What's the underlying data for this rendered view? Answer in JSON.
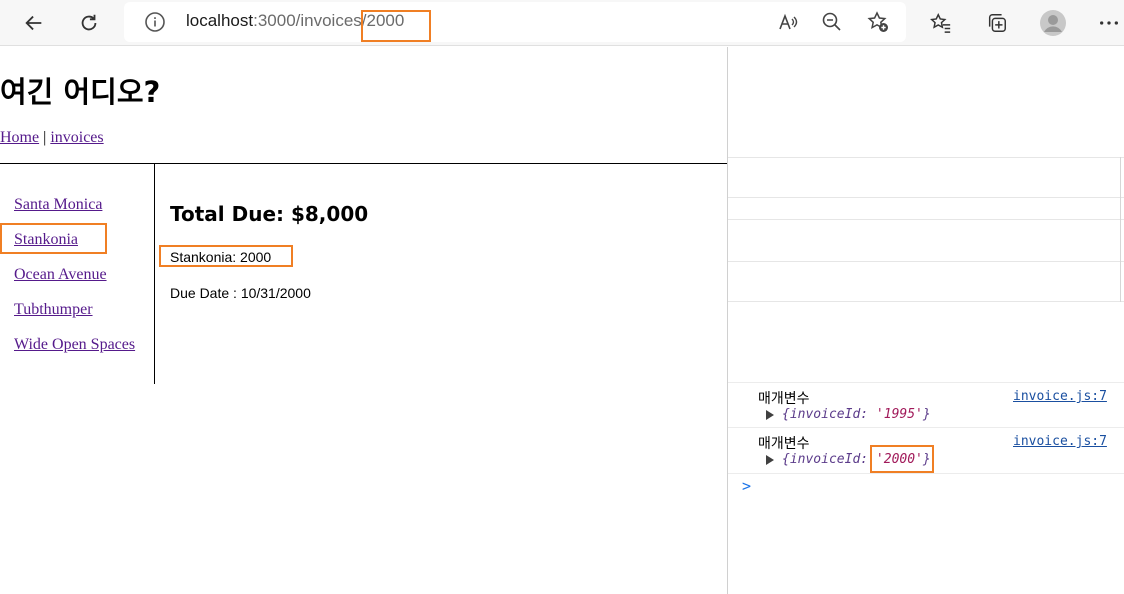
{
  "browser": {
    "url_host": "localhost",
    "url_path_prefix": ":3000/invoices",
    "url_path_highlight": "/2000",
    "icons": {
      "back": "back-arrow-icon",
      "refresh": "refresh-icon",
      "info": "info-icon",
      "read_aloud": "read-aloud-icon",
      "zoom_out": "zoom-out-icon",
      "add_favorite": "add-favorite-icon",
      "favorites": "favorites-icon",
      "collections": "collections-icon",
      "profile": "profile-icon",
      "more": "more-icon"
    }
  },
  "page": {
    "heading": "여긴 어디오?",
    "nav": {
      "home": "Home",
      "separator": " | ",
      "invoices": "invoices"
    },
    "sidebar": {
      "items": [
        "Santa Monica",
        "Stankonia",
        "Ocean Avenue",
        "Tubthumper",
        "Wide Open Spaces"
      ]
    },
    "invoice": {
      "total_due": "Total Due: $8,000",
      "name_line": "Stankonia: 2000",
      "due_date": "Due Date : 10/31/2000"
    }
  },
  "devtools": {
    "console": [
      {
        "label": "매개변수",
        "source": "invoice.js:7",
        "obj_prefix": "{invoiceId: ",
        "obj_value": "'1995'",
        "obj_suffix": "}"
      },
      {
        "label": "매개변수",
        "source": "invoice.js:7",
        "obj_prefix": "{invoiceId: ",
        "obj_value": "'2000'",
        "obj_suffix": "}"
      }
    ],
    "prompt": ">"
  },
  "colors": {
    "highlight": "#f07f24",
    "link": "#551a8b",
    "console_link": "#1a4fa0",
    "console_string": "#a11a5a"
  }
}
